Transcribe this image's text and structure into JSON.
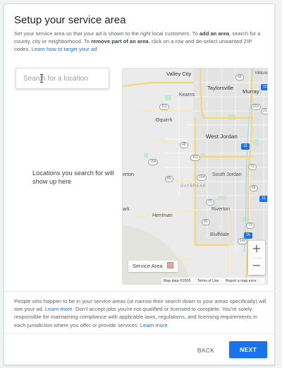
{
  "header": {
    "title": "Setup your service area"
  },
  "intro": {
    "part1": "Set your service area so that your ad is shown to the right local customers. To ",
    "bold1": "add an area",
    "part2": ", search for a county, city or neighborhood. To ",
    "bold2": "remove part of an area",
    "part3": ", click on a row and de-select unwanted ZIP codes. ",
    "link": "Learn how to target your ad"
  },
  "search": {
    "placeholder": "Search for a location"
  },
  "empty_state": {
    "text": "Locations you search for will show up here"
  },
  "map": {
    "labels": {
      "valley_city": "Valley City",
      "millcreek": "Millcre",
      "kearns": "Kearns",
      "taylorsville": "Taylorsville",
      "murray": "Murray",
      "oquirrh": "Oquirrh",
      "west_jordan": "West Jordan",
      "south_jordan": "South Jordan",
      "daybreak": "DAYBREAK",
      "herriman": "Herriman",
      "riverton": "Riverton",
      "bluffdale": "Bluffdale",
      "berton": "erton",
      "lark": "ark"
    },
    "shields": {
      "s111a": "111",
      "s68a": "68",
      "s201": "201",
      "s215": "215",
      "s15a": "15",
      "s48": "48",
      "s111b": "111",
      "s154a": "154",
      "s154b": "154",
      "s85a": "85",
      "s15b": "15",
      "s15c": "15",
      "s71a": "71",
      "s71b": "71",
      "s71c": "71",
      "s68b": "68",
      "s85b": "85",
      "s15d": "15",
      "s140": "140"
    },
    "legend_label": "Service Area",
    "footer": {
      "data": "Map data ©2020",
      "terms": "Terms of Use",
      "report": "Report a map error"
    },
    "zoom_in": "+",
    "zoom_out": "−",
    "colors": {
      "service_area": "#e6a49a",
      "highway": "#f6d776",
      "water": "#aadaff",
      "park": "#c8e6c9"
    }
  },
  "notice": {
    "part1": "People who happen to be in your service areas (or narrow their search down to your areas specifically) will see your ad. ",
    "link1": "Learn more",
    "part2": ". Don't accept jobs you're not qualified or licensed to complete. You're solely responsible for maintaining compliance with applicable laws, regulations, and licensing requirements in each jurisdiction where you offer or provide services. ",
    "link2": "Learn more"
  },
  "footer": {
    "back_label": "BACK",
    "next_label": "NEXT",
    "accent_color": "#1a73e8"
  }
}
